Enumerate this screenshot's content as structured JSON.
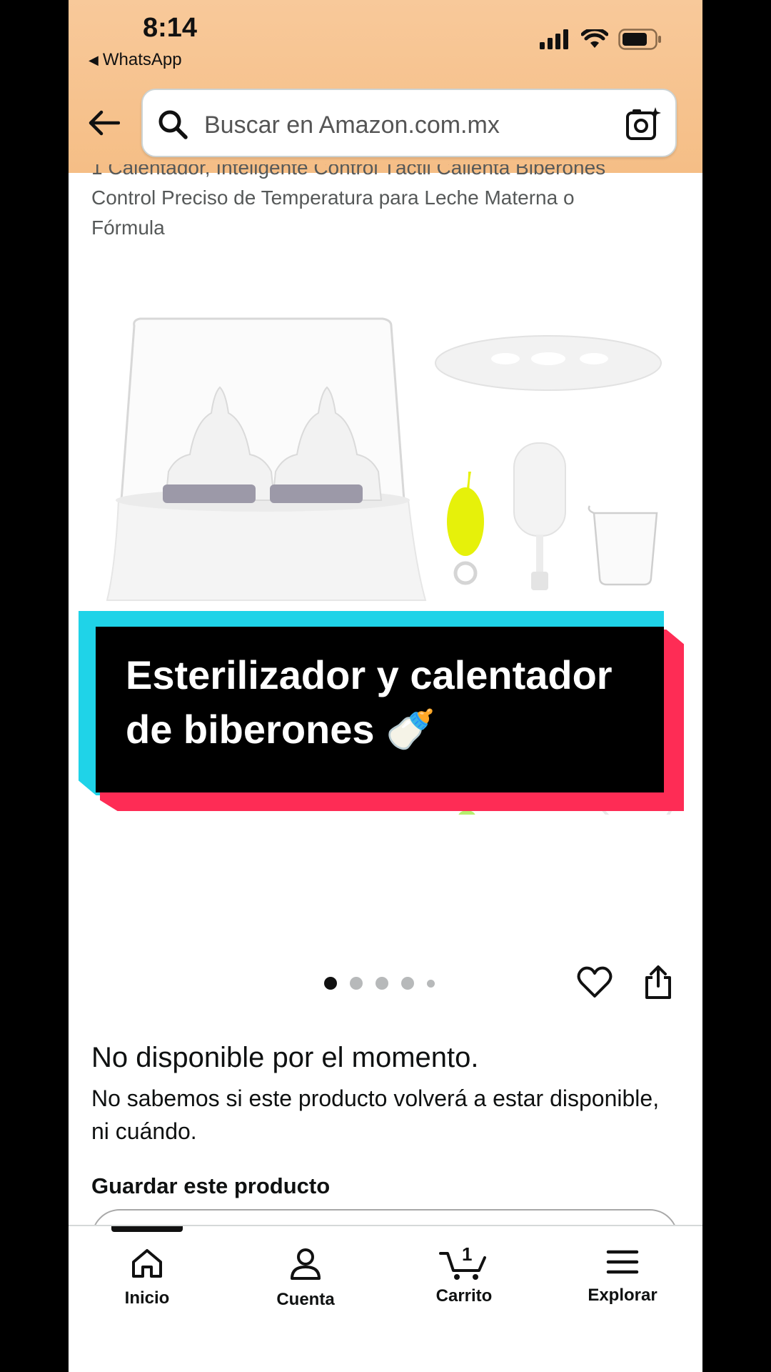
{
  "status_bar": {
    "time": "8:14",
    "back_app": "WhatsApp"
  },
  "header": {
    "search_placeholder": "Buscar en Amazon.com.mx"
  },
  "product": {
    "title_cut": "1 Calentador, Inteligente Control Táctil Calienta Biberones",
    "title_line2": "Control Preciso de Temperatura para Leche Materna o",
    "title_line3": "Fórmula"
  },
  "overlay": {
    "caption_line1": "Esterilizador y calentador",
    "caption_line2": "de biberones",
    "caption_emoji": "🍼"
  },
  "availability": {
    "heading": "No disponible por el momento.",
    "description": "No sabemos si este producto volverá a estar disponible, ni cuándo.",
    "save_label": "Guardar este producto"
  },
  "tabbar": {
    "items": [
      {
        "label": "Inicio",
        "icon": "home-icon"
      },
      {
        "label": "Cuenta",
        "icon": "account-icon"
      },
      {
        "label": "Carrito",
        "icon": "cart-icon",
        "badge": "1"
      },
      {
        "label": "Explorar",
        "icon": "menu-icon"
      }
    ]
  },
  "gallery": {
    "total_images": 5,
    "active_index": 0
  }
}
